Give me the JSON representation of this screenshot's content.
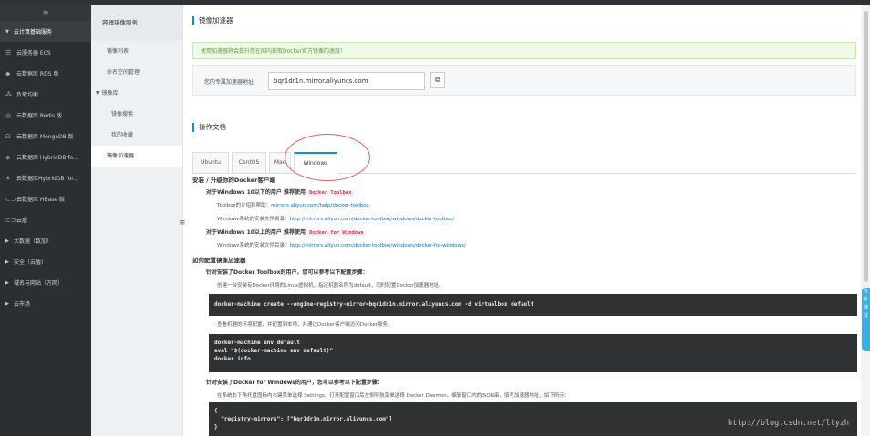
{
  "nav": {
    "top_icon": "≡",
    "section_label": "云计算基础服务",
    "items": [
      {
        "icon": "☰",
        "label": "云服务器 ECS"
      },
      {
        "icon": "◆",
        "label": "云数据库 RDS 版"
      },
      {
        "icon": "⁂",
        "label": "负载均衡"
      },
      {
        "icon": "◎",
        "label": "云数据库 Redis 版"
      },
      {
        "icon": "⊡",
        "label": "云数据库 MongoDB 版"
      },
      {
        "icon": "◈",
        "label": "云数据库 HybridDB fo..."
      },
      {
        "icon": "✶",
        "label": "云数据库HybridDB for..."
      },
      {
        "icon": "⊂⊃",
        "label": "云数据库 HBase 版"
      },
      {
        "icon": "⊂⊃",
        "label": "云盾"
      }
    ],
    "groups": [
      {
        "label": "大数据（数加）"
      },
      {
        "label": "安全（云盾）"
      },
      {
        "label": "域名与网站（万网）"
      },
      {
        "label": "云市场"
      }
    ]
  },
  "subnav": {
    "title": "容器镜像服务",
    "items": [
      {
        "label": "镜像列表"
      },
      {
        "label": "命名空间管理"
      },
      {
        "label": "镜像库"
      },
      {
        "label": "镜像搜索"
      },
      {
        "label": "我的收藏"
      },
      {
        "label": "镜像加速器"
      }
    ]
  },
  "main": {
    "title": "镜像加速器",
    "notice": "使用加速器将会提升您在国内获取Docker官方镜像的速度！",
    "addr_label": "您的专属加速器地址",
    "addr_value": "bqr1dr1n.mirror.aliyuncs.com",
    "ops_title": "操作文档",
    "tabs": [
      {
        "label": "Ubuntu"
      },
      {
        "label": "CentOS"
      },
      {
        "label": "Mac"
      },
      {
        "label": "Windows"
      }
    ]
  },
  "doc": {
    "h_install": "安装 / 升级你的Docker客户端",
    "win10_below": "对于Windows 10以下的用户 推荐使用",
    "docker_toolbox": "Docker Toolbox",
    "toolbox_addr_label": "Toolbox的介绍和帮助：",
    "toolbox_addr_link": "mirrors.aliyun.com/help/docker-toolbox",
    "win_install_dir1_label": "Windows系统的安装文件目录：",
    "win_install_dir1_link": "http://mirrors.aliyun.com/docker-toolbox/windows/docker-toolbox/",
    "win10_above": "对于Windows 10以上的用户 推荐使用",
    "docker_for_windows": "Docker for Windows",
    "win_install_dir2_label": "Windows系统的安装文件目录：",
    "win_install_dir2_link": "http://mirrors.aliyun.com/docker-toolbox/windows/docker-for-windows/",
    "h_config": "如何配置镜像加速器",
    "toolbox_users": "针对安装了Docker Toolbox的用户，您可以参考以下配置步骤：",
    "toolbox_step1": "创建一台安装有Docker环境的Linux虚拟机，指定机器名称为default，同时配置Docker加速器地址。",
    "code1": "docker-machine create --engine-registry-mirror=bqr1dr1n.mirror.aliyuncs.com -d virtualbox default",
    "toolbox_step2": "查看机器的环境配置，并配置到本地，并通过Docker客户端访问Docker服务。",
    "code2": "docker-machine env default\neval \"$(docker-machine env default)\"\ndocker info",
    "dfw_users": "针对安装了Docker for Windows的用户，您可以参考以下配置步骤：",
    "dfw_step1": "在系统右下角托盘图标内右键菜单选择 Settings，打开配置窗口后左侧导航菜单选择 Docker Daemon。编辑窗口内的JSON串，填写加速器地址，如下所示：",
    "code3": "{\n  \"registry-mirrors\": [\"bqr1dr1n.mirror.aliyuncs.com\"]\n}"
  },
  "float_tab": "咨询·建议",
  "watermark": "http://blog.csdn.net/ltyzh"
}
